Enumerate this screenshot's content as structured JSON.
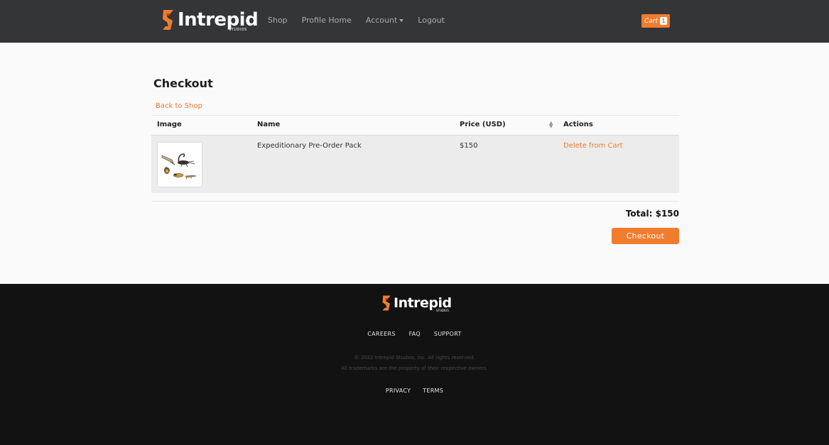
{
  "header": {
    "logo_text": "Intrepid",
    "logo_sub": "STUDIOS",
    "nav": [
      "Shop",
      "Profile Home",
      "Account",
      "Logout"
    ],
    "cart_label": "Cart",
    "cart_count": "1"
  },
  "main": {
    "title": "Checkout",
    "back_link": "Back to Shop",
    "columns": [
      "Image",
      "Name",
      "Price (USD)",
      "Actions"
    ],
    "rows": [
      {
        "name": "Expeditionary Pre-Order Pack",
        "price": "$150",
        "action": "Delete from Cart"
      }
    ],
    "total": "Total: $150",
    "checkout_label": "Checkout"
  },
  "footer": {
    "logo_text": "Intrepid",
    "logo_sub": "STUDIOS",
    "links": [
      "CAREERS",
      "FAQ",
      "SUPPORT"
    ],
    "copyright": "© 2022 Intrepid Studios, Inc. All rights reserved.",
    "trademarks": "All trademarks are the property of their respective owners.",
    "legal_links": [
      "PRIVACY",
      "TERMS"
    ]
  },
  "colors": {
    "accent": "#f07c2e",
    "navbar": "#333537",
    "footer": "#121212"
  }
}
